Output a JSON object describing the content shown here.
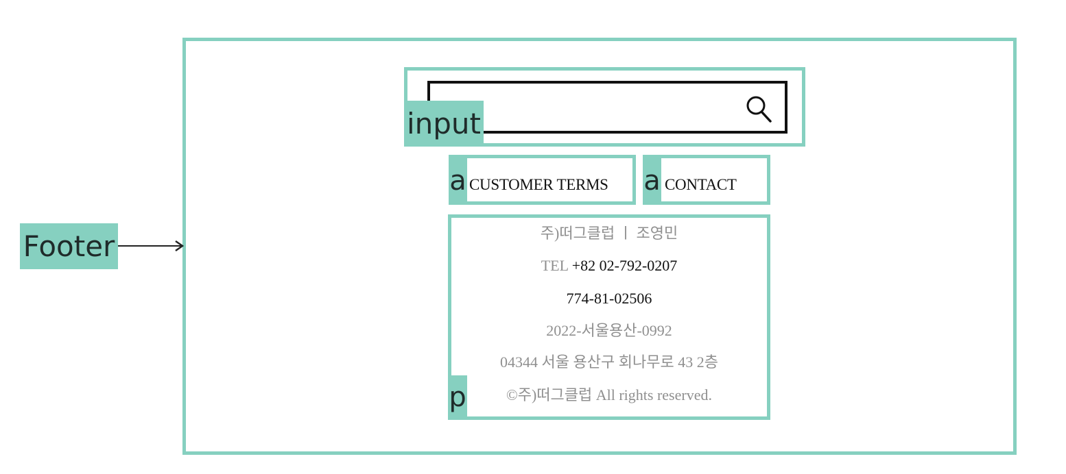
{
  "labels": {
    "footer": "Footer",
    "input": "input",
    "anchor_1": "a",
    "anchor_2": "a",
    "paragraph": "p"
  },
  "links": {
    "customer_terms": "CUSTOMER TERMS",
    "contact": "CONTACT"
  },
  "search": {
    "icon": "search-icon",
    "value": ""
  },
  "info": {
    "company": "주)떠그클럽 ㅣ 조영민",
    "tel_label": "TEL ",
    "tel_number": "+82 02-792-0207",
    "business_number": "774-81-02506",
    "permit": "2022-서울용산-0992",
    "address": "04344 서울 용산구 회나무로 43 2층",
    "copyright": "©주)떠그클럽 All rights reserved."
  },
  "colors": {
    "annotation": "#86d0c0",
    "muted_text": "#8f8f8f",
    "dark_text": "#111111"
  }
}
